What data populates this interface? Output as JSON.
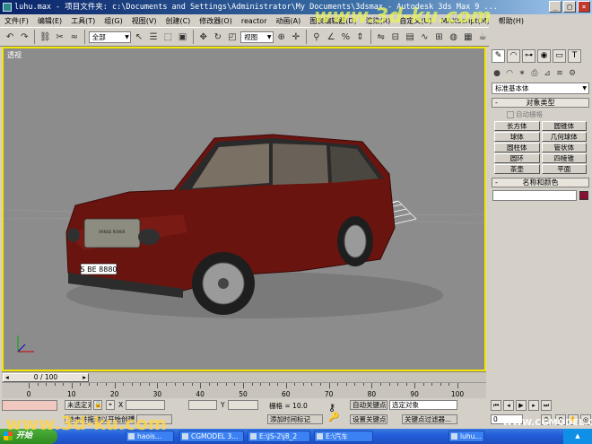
{
  "window": {
    "title": "luhu.max - 项目文件夹: c:\\Documents and Settings\\Administrator\\My Documents\\3dsmax - Autodesk 3ds Max 9 ...",
    "minimize": "_",
    "maximize": "□",
    "close": "×"
  },
  "menu": [
    "文件(F)",
    "编辑(E)",
    "工具(T)",
    "组(G)",
    "视图(V)",
    "创建(C)",
    "修改器(O)",
    "reactor",
    "动画(A)",
    "图表编辑器(D)",
    "渲染(R)",
    "自定义(U)",
    "MAXScript(M)",
    "帮助(H)"
  ],
  "toolbar": {
    "selection_filter": "全部",
    "reference_coord": "视图"
  },
  "viewport": {
    "label": "透视",
    "plate_text": "S BE 8880",
    "grille_text": "RANGE ROVER",
    "body_color": "#6a1410"
  },
  "command_panel": {
    "category": "标准基本体",
    "object_type_title": "对象类型",
    "autogrid_label": "自动栅格",
    "object_buttons": [
      "长方体",
      "圆锥体",
      "球体",
      "几何球体",
      "圆柱体",
      "管状体",
      "圆环",
      "四棱锥",
      "茶壶",
      "平面"
    ],
    "name_color_title": "名称和颜色",
    "object_color": "#8a1030"
  },
  "timeline": {
    "frame_display": "0 / 100",
    "ticks": [
      "0",
      "10",
      "20",
      "30",
      "40",
      "50",
      "60",
      "70",
      "80",
      "90",
      "100"
    ]
  },
  "status": {
    "selection": "未选定对",
    "prompt": "单击并拖动以开始创建过程",
    "x_label": "X",
    "y_label": "Y",
    "grid_label": "栅格 = 10.0",
    "add_time_tag": "添加时间标记",
    "auto_key": "自动关键点",
    "set_key": "设置关键点",
    "key_filter_value": "选定对象",
    "key_filters": "关键点过滤器...",
    "frame_value": "0"
  },
  "taskbar": {
    "start": "开始",
    "items": [
      "haois...",
      "CGMODEL 3...",
      "E:\\JS-2\\j8_2",
      "E:\\汽车",
      "luhu..."
    ]
  },
  "watermarks": {
    "top": "www.3d-ku.com",
    "bottom_left": "www.3d-ku.com",
    "bottom_right": "WWW.CGMODEL.CN"
  }
}
